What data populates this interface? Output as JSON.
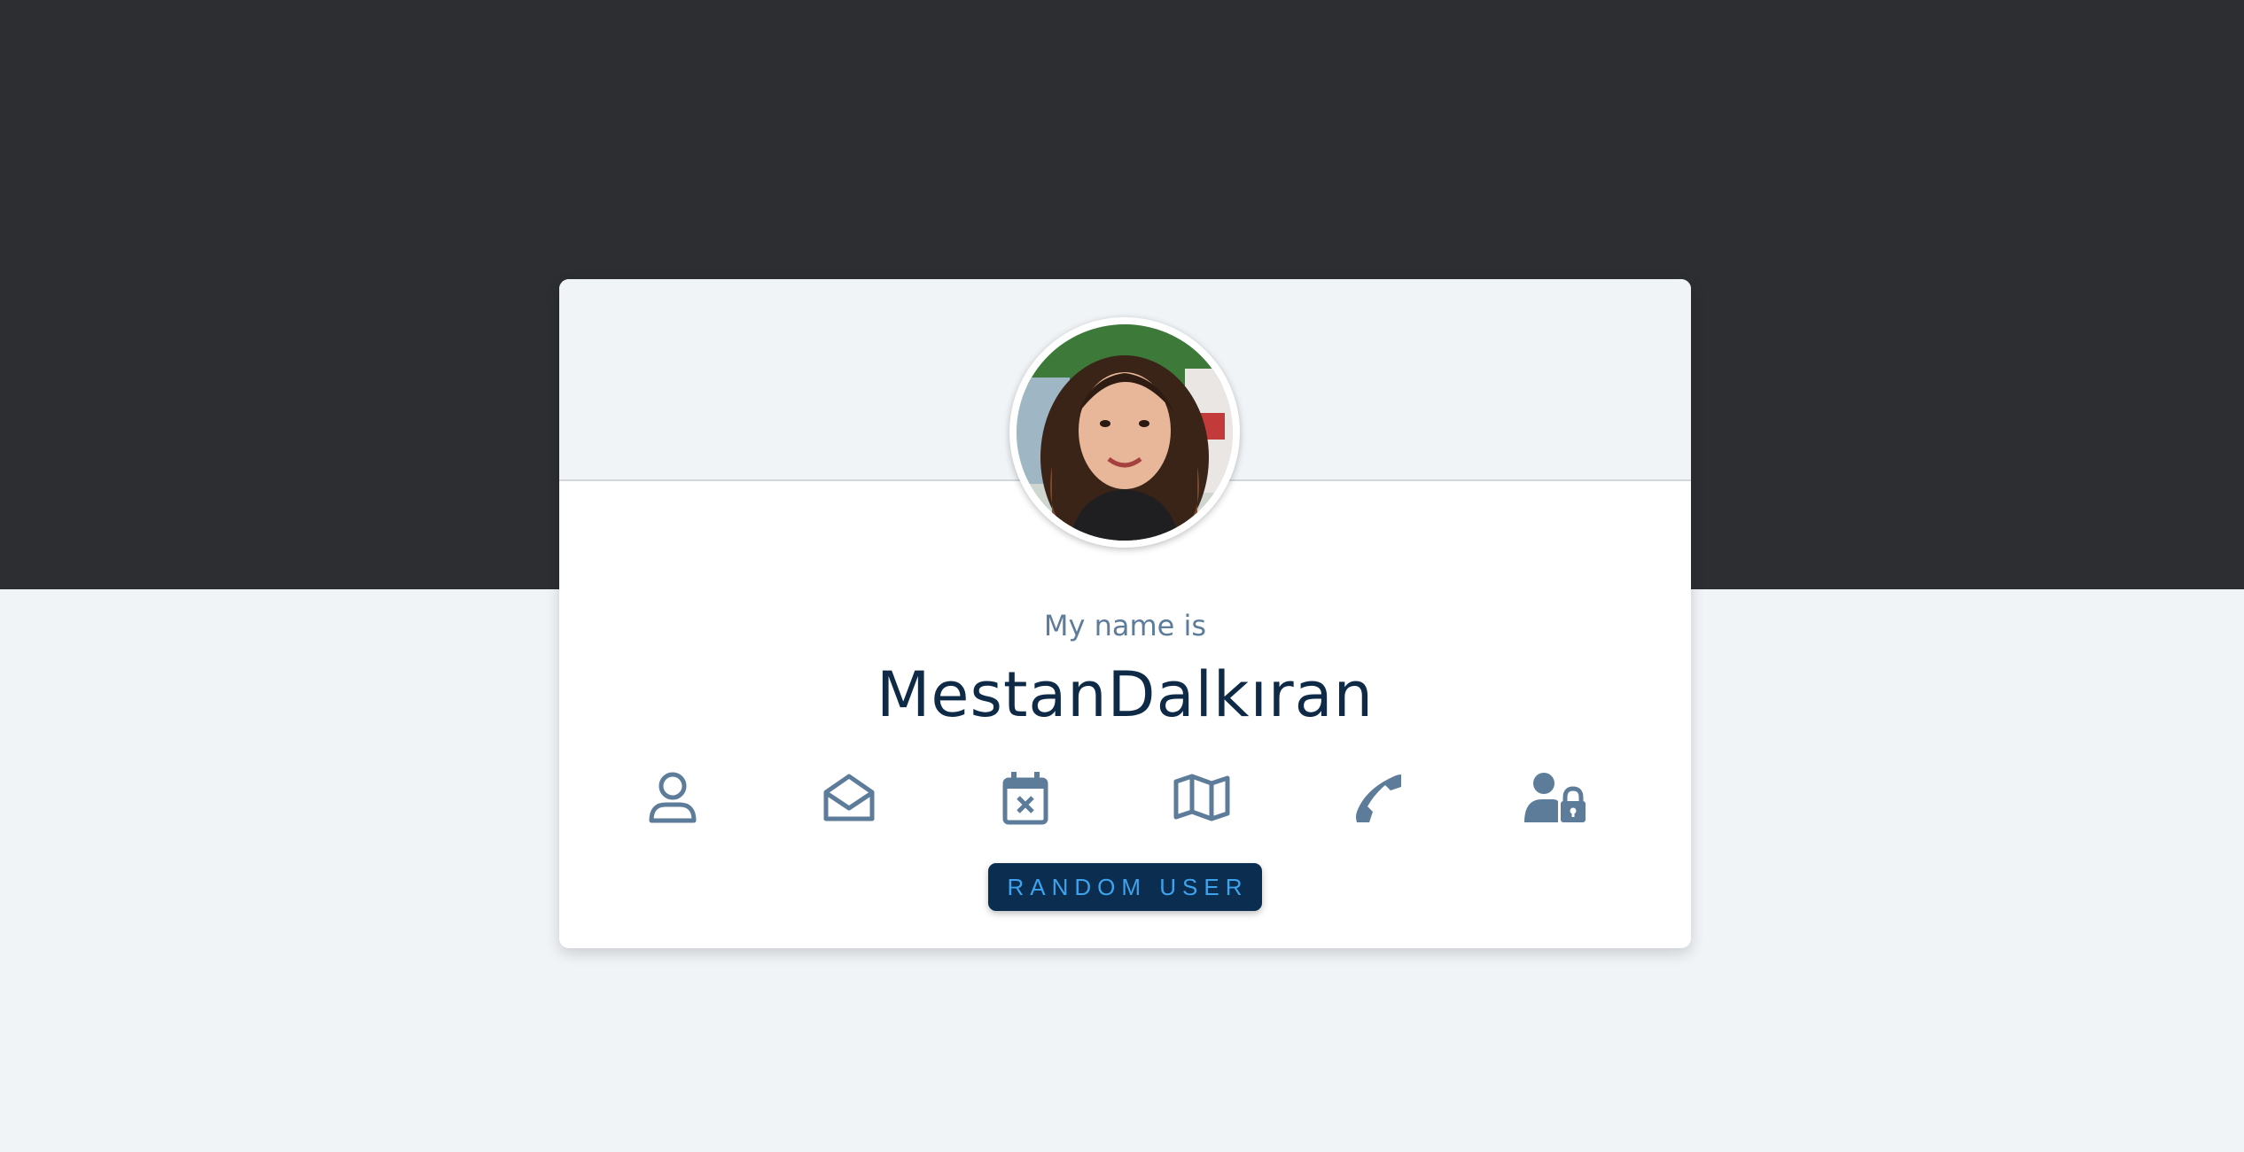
{
  "card": {
    "subtitle": "My name is",
    "name": "MestanDalkıran"
  },
  "icons": [
    "user-icon",
    "envelope-open-icon",
    "calendar-x-icon",
    "map-icon",
    "phone-icon",
    "user-lock-icon"
  ],
  "button": {
    "label": "RANDOM USER"
  },
  "colors": {
    "background_dark": "#2d2e32",
    "background_light": "#f1f4f7",
    "card": "#ffffff",
    "icon": "#5d7c9a",
    "name_text": "#0e2a47",
    "button_bg": "#0b2d4f",
    "button_text": "#3ea3ee"
  }
}
